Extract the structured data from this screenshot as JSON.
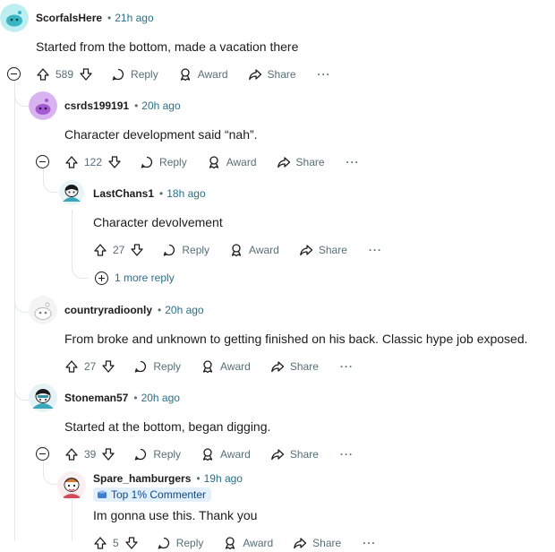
{
  "comments": [
    {
      "user": "ScorfalsHere",
      "time": "21h ago",
      "text": "Started from the bottom, made a vacation there",
      "score": "589"
    },
    {
      "user": "csrds199191",
      "time": "20h ago",
      "text": "Character development said “nah”.",
      "score": "122"
    },
    {
      "user": "LastChans1",
      "time": "18h ago",
      "text": "Character devolvement",
      "score": "27"
    },
    {
      "user": "countryradioonly",
      "time": "20h ago",
      "text": "From broke and unknown to getting finished on his back. Classic hype job exposed.",
      "score": "27"
    },
    {
      "user": "Stoneman57",
      "time": "20h ago",
      "text": "Started at the bottom, began digging.",
      "score": "39"
    },
    {
      "user": "Spare_hamburgers",
      "time": "19h ago",
      "text": "Im gonna use this. Thank you",
      "score": "5",
      "badge": "Top 1% Commenter"
    }
  ],
  "labels": {
    "reply": "Reply",
    "award": "Award",
    "share": "Share",
    "more": "···",
    "dot": "•",
    "more_replies": "1 more reply"
  },
  "colors": {
    "meta_link": "#2a6f89",
    "muted": "#576f76",
    "thread": "#e3e6e8",
    "badge_bg": "#e3f0fb"
  }
}
